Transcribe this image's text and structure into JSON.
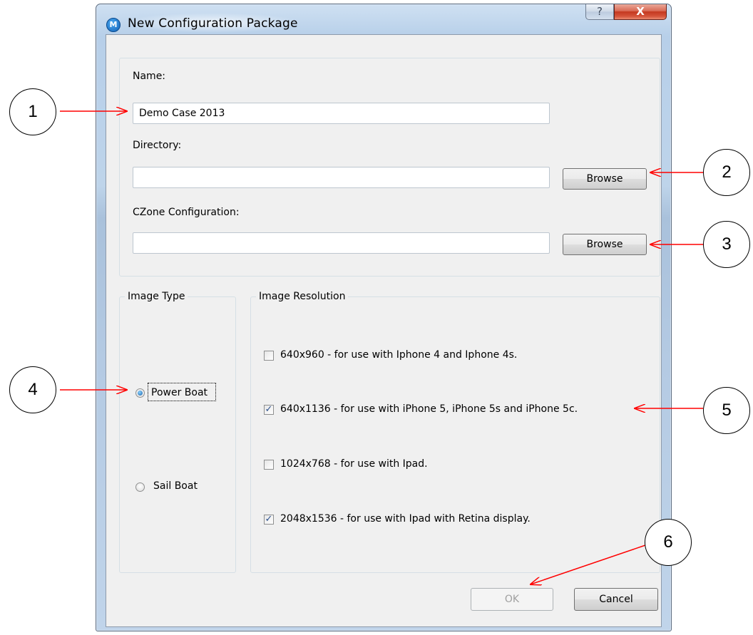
{
  "window": {
    "title": "New Configuration Package",
    "logo_letter": "M",
    "help_glyph": "?",
    "close_glyph": "X"
  },
  "form": {
    "name_label": "Name:",
    "name_value": "Demo Case 2013",
    "directory_label": "Directory:",
    "directory_value": "",
    "czone_label": "CZone Configuration:",
    "czone_value": "",
    "browse_label": "Browse"
  },
  "image_type": {
    "title": "Image Type",
    "options": [
      {
        "label": "Power Boat",
        "selected": true
      },
      {
        "label": "Sail Boat",
        "selected": false
      }
    ]
  },
  "image_resolution": {
    "title": "Image Resolution",
    "options": [
      {
        "label": "640x960 - for use with Iphone 4 and Iphone 4s.",
        "checked": false
      },
      {
        "label": "640x1136 - for use with iPhone 5, iPhone 5s and iPhone 5c.",
        "checked": true
      },
      {
        "label": "1024x768 - for use with Ipad.",
        "checked": false
      },
      {
        "label": "2048x1536 - for use with Ipad with Retina display.",
        "checked": true
      }
    ]
  },
  "buttons": {
    "ok_label": "OK",
    "ok_enabled": false,
    "cancel_label": "Cancel"
  },
  "callouts": [
    "1",
    "2",
    "3",
    "4",
    "5",
    "6"
  ],
  "colors": {
    "arrow": "#ff0000",
    "check": "#2a4f8c"
  }
}
